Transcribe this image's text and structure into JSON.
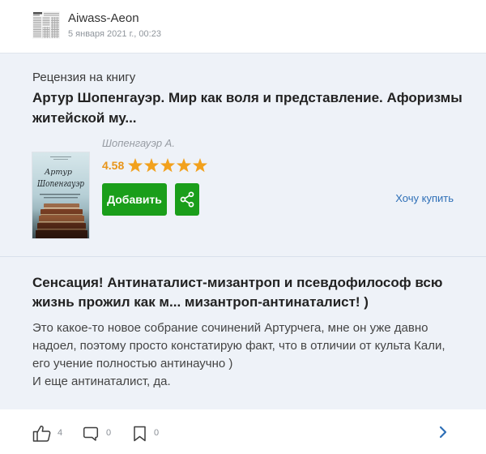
{
  "icons": {
    "avatar": "avatar-image",
    "star": "star-icon",
    "share": "share-icon",
    "like": "thumbs-up-icon",
    "comment": "comment-icon",
    "bookmark": "bookmark-icon",
    "open": "chevron-right-icon"
  },
  "colors": {
    "panel_bg": "#eef2f8",
    "accent_green": "#1a9e1a",
    "star_orange": "#f2a11d",
    "rating_orange": "#e8951a",
    "link_blue": "#2e6fb7",
    "text_dark": "#222222"
  },
  "header": {
    "user_name": "Aiwass-Aeon",
    "date": "5 января 2021 г., 00:23"
  },
  "book": {
    "section_label": "Рецензия на книгу",
    "title_lines": [
      "Артур Шопенгауэр. Мир как воля и представление. Афоризмы",
      "житейской му..."
    ],
    "author": "Шопенгауэр А.",
    "rating": "4.58",
    "stars_filled": 5,
    "stars_total": 5,
    "add_label": "Добавить",
    "want_to_buy_label": "Хочу купить",
    "cover_lettering": [
      "Артур",
      "Шопенгауэр"
    ]
  },
  "review": {
    "title_lines": [
      "Сенсация! Антинаталист-мизантроп и псевдофилософ всю",
      "жизнь прожил как м... мизантроп-антинаталист! )"
    ],
    "body_lines": [
      "Это какое-то новое собрание сочинений Артурчега, мне он уже давно",
      "надоел, поэтому просто констатирую факт, что в отличии от культа Кали,",
      "его учение полностью антинаучно )",
      "И еще антинаталист, да."
    ]
  },
  "actions": {
    "likes": "4",
    "comments": "0",
    "bookmarks": "0"
  }
}
